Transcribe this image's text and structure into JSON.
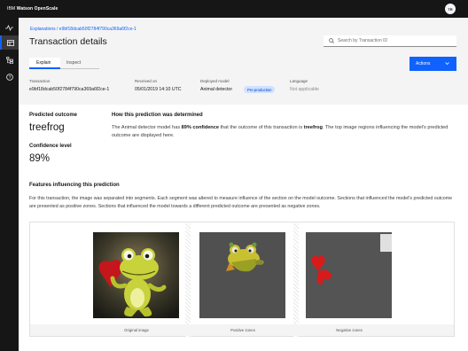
{
  "topbar": {
    "brand_prefix": "IBM",
    "brand_name": "Watson OpenScale",
    "avatar_initials": "TR"
  },
  "rail": {
    "icons": [
      "activity-icon",
      "dashboard-icon",
      "tree-icon",
      "help-icon"
    ],
    "active_index": 1,
    "accent": "#0f62fe"
  },
  "header": {
    "breadcrumb": "Explanations / e9bf18dcab50f2784f790ca369a6f2ce-1",
    "title": "Transaction details",
    "search_placeholder": "Search by Transaction ID",
    "tabs": [
      "Explain",
      "Inspect"
    ],
    "actions_label": "Actions"
  },
  "meta": {
    "transaction_label": "Transaction",
    "transaction_value": "e9bf18dcab50f2784f790ca369a6f2ce-1",
    "received_label": "Received on",
    "received_value": "05/01/2019 14:10 UTC",
    "model_label": "Deployed model",
    "model_value": "Animal detector",
    "model_tag": "Pre-production",
    "language_label": "Language",
    "language_value": "Not applicable"
  },
  "prediction": {
    "outcome_label": "Predicted outcome",
    "outcome_value": "treefrog",
    "confidence_label": "Confidence level",
    "confidence_value": "89%"
  },
  "how": {
    "title": "How this prediction was determined",
    "text_before": "The Animal detector model has ",
    "confidence": "89% confidence",
    "text_middle": " that the outcome of this transaction is ",
    "outcome": "treefrog",
    "text_after": ". The top image regions influencing the model's predicted outcome are displayed here."
  },
  "features": {
    "title": "Features influencing this prediction",
    "text": "For this transaction, the image was separated into segments. Each segment was altered to measure influence of the section on the model outcome. Sections that influenced the model's predicted outcome are presented as positive zones. Sections that influenced the model towards a different  predicted outcome are presented as negative zones."
  },
  "images": {
    "original_caption": "Original image",
    "positive_caption": "Positive zones",
    "negative_caption": "Negative zones"
  }
}
